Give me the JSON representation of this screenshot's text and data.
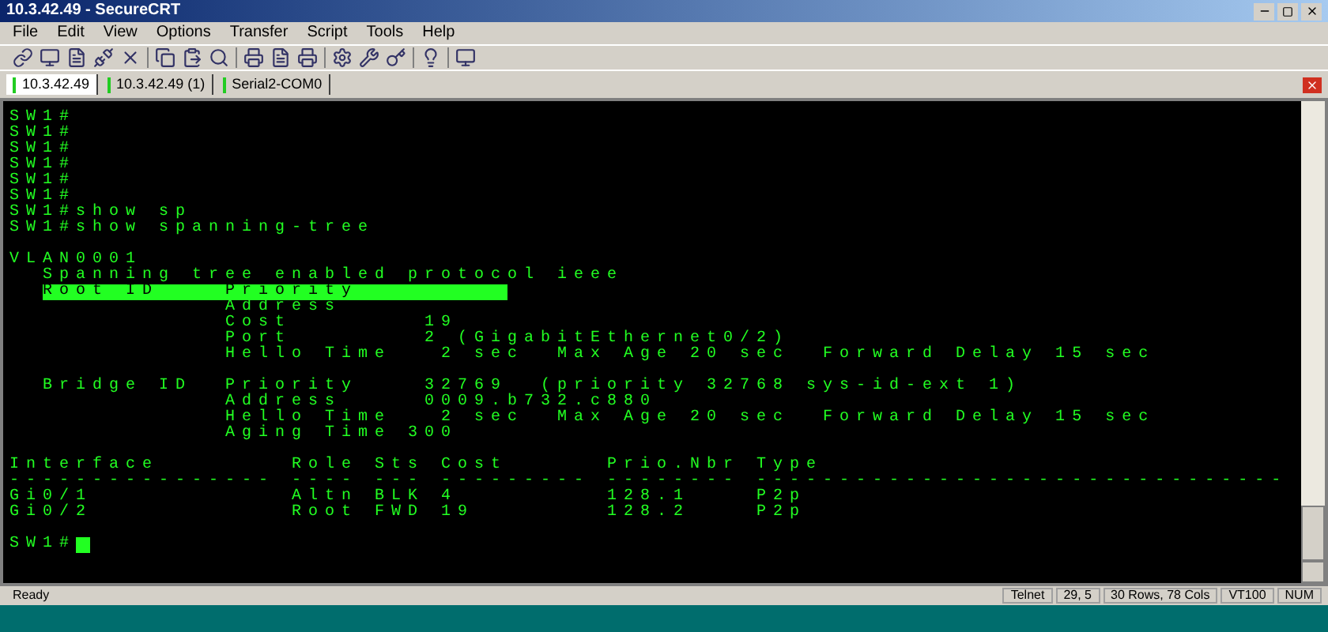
{
  "window": {
    "title": "10.3.42.49 - SecureCRT"
  },
  "menu": [
    "File",
    "Edit",
    "View",
    "Options",
    "Transfer",
    "Script",
    "Tools",
    "Help"
  ],
  "tabs": [
    {
      "label": "10.3.42.49",
      "selected": true
    },
    {
      "label": "10.3.42.49 (1)",
      "selected": false
    },
    {
      "label": "Serial2-COM0",
      "selected": false
    }
  ],
  "terminal": {
    "cursor": true,
    "lines": [
      {
        "text": "SW1#",
        "highlighted": false
      },
      {
        "text": "SW1#",
        "highlighted": false
      },
      {
        "text": "SW1#",
        "highlighted": false
      },
      {
        "text": "SW1#",
        "highlighted": false
      },
      {
        "text": "SW1#",
        "highlighted": false
      },
      {
        "text": "SW1#",
        "highlighted": false
      },
      {
        "text": "SW1#show sp",
        "highlighted": false
      },
      {
        "text": "SW1#show spanning-tree",
        "highlighted": false
      },
      {
        "highlighted": false
      },
      {
        "text": "VLAN0001",
        "highlighted": false
      },
      {
        "text": "  Spanning tree enabled protocol ieee",
        "highlighted": false
      },
      {
        "text": "  Root ID    Priority",
        "highlighted": true
      },
      {
        "text": "             Address",
        "highlighted": false
      },
      {
        "text": "             Cost        19",
        "highlighted": false
      },
      {
        "text": "             Port        2 (GigabitEthernet0/2)",
        "highlighted": false
      },
      {
        "text": "             Hello Time   2 sec  Max Age 20 sec  Forward Delay 15 sec",
        "highlighted": false
      },
      {
        "highlighted": false
      },
      {
        "text": "  Bridge ID  Priority    32769  (priority 32768 sys-id-ext 1)",
        "highlighted": false
      },
      {
        "text": "             Address     0009.b732.c880",
        "highlighted": false
      },
      {
        "text": "             Hello Time   2 sec  Max Age 20 sec  Forward Delay 15 sec",
        "highlighted": false
      },
      {
        "text": "             Aging Time 300",
        "highlighted": false
      },
      {
        "highlighted": false
      },
      {
        "text": "Interface        Role Sts Cost      Prio.Nbr Type",
        "highlighted": false
      },
      {
        "text": "---------------- ---- --- --------- -------- --------------------------------",
        "highlighted": false
      },
      {
        "text": "Gi0/1            Altn BLK 4         128.1    P2p",
        "highlighted": false
      },
      {
        "text": "Gi0/2            Root FWD 19        128.2    P2p",
        "highlighted": false
      },
      {
        "highlighted": false
      },
      {
        "text": "SW1#",
        "highlighted": false
      }
    ]
  },
  "status_bar": [
    "Ready",
    "Telnet",
    "29,  5",
    "30 Rows, 78 Cols",
    "VT100",
    "NUM"
  ]
}
